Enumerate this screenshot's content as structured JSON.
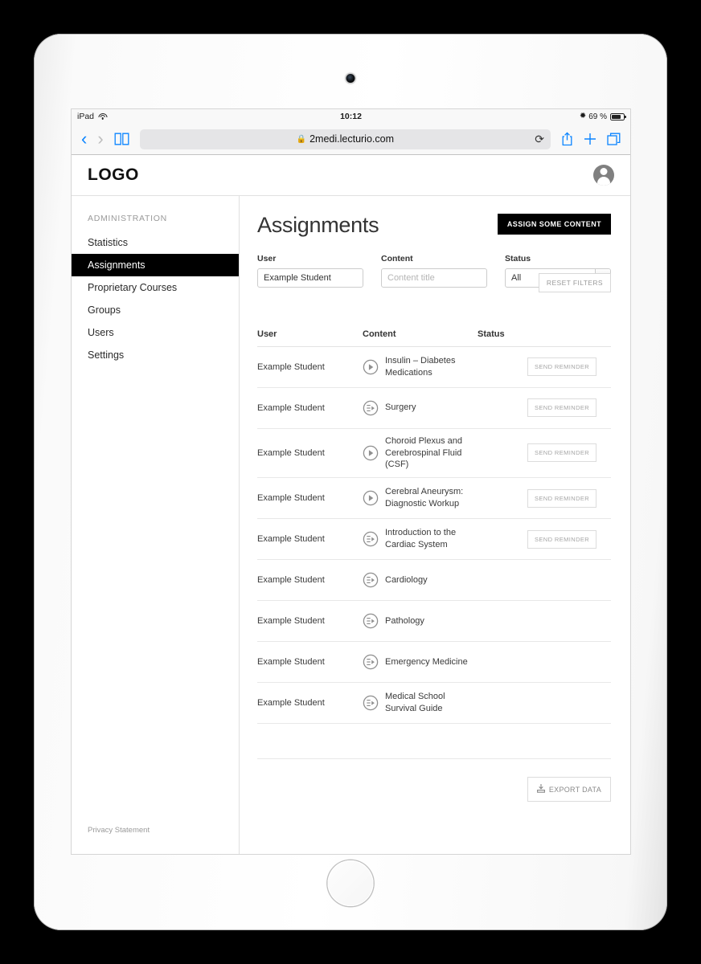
{
  "status_bar": {
    "device": "iPad",
    "wifi_icon": "wifi-icon",
    "time": "10:12",
    "bluetooth_icon": "bluetooth-icon",
    "battery_text": "69 %",
    "battery_icon": "battery-icon"
  },
  "browser": {
    "back_icon": "chevron-left-icon",
    "forward_icon": "chevron-right-icon",
    "bookmarks_icon": "book-icon",
    "lock_icon": "lock-icon",
    "url": "2medi.lecturio.com",
    "reload_icon": "reload-icon",
    "share_icon": "share-icon",
    "new_tab_icon": "plus-icon",
    "tabs_icon": "tabs-icon"
  },
  "app_header": {
    "logo": "LOGO",
    "avatar_icon": "user-avatar-icon"
  },
  "sidebar": {
    "section_title": "ADMINISTRATION",
    "items": [
      {
        "label": "Statistics",
        "active": false
      },
      {
        "label": "Assignments",
        "active": true
      },
      {
        "label": "Proprietary Courses",
        "active": false
      },
      {
        "label": "Groups",
        "active": false
      },
      {
        "label": "Users",
        "active": false
      },
      {
        "label": "Settings",
        "active": false
      }
    ],
    "privacy_link": "Privacy Statement"
  },
  "main": {
    "page_title": "Assignments",
    "assign_button": "ASSIGN SOME CONTENT",
    "reset_button": "RESET FILTERS",
    "export_button": "EXPORT DATA",
    "export_icon": "export-icon"
  },
  "filters": {
    "user": {
      "label": "User",
      "value": "Example Student",
      "placeholder": "User"
    },
    "content": {
      "label": "Content",
      "value": "",
      "placeholder": "Content title"
    },
    "status": {
      "label": "Status",
      "selected": "All",
      "options": [
        "All"
      ],
      "chevron_icon": "chevron-down-icon"
    }
  },
  "table": {
    "columns": [
      "User",
      "Content",
      "Status",
      ""
    ],
    "reminder_label": "SEND REMINDER",
    "rows": [
      {
        "user": "Example Student",
        "content": "Insulin – Diabetes Medications",
        "content_icon": "video-play-icon",
        "status": "orange",
        "status_icon": "warning-dot-icon",
        "has_reminder": true
      },
      {
        "user": "Example Student",
        "content": "Surgery",
        "content_icon": "course-playlist-icon",
        "status": "orange",
        "status_icon": "warning-dot-icon",
        "has_reminder": true
      },
      {
        "user": "Example Student",
        "content": "Choroid Plexus and Cerebrospinal Fluid (CSF)",
        "content_icon": "video-play-icon",
        "status": "orange",
        "status_icon": "warning-dot-icon",
        "has_reminder": true
      },
      {
        "user": "Example Student",
        "content": "Cerebral Aneurysm: Diagnostic Workup",
        "content_icon": "video-play-icon",
        "status": "orange",
        "status_icon": "warning-dot-icon",
        "has_reminder": true
      },
      {
        "user": "Example Student",
        "content": "Introduction to the Cardiac System",
        "content_icon": "course-playlist-icon",
        "status": "orange",
        "status_icon": "plain-dot-icon",
        "has_reminder": true
      },
      {
        "user": "Example Student",
        "content": "Cardiology",
        "content_icon": "course-playlist-icon",
        "status": "gray",
        "status_icon": "plain-dot-icon",
        "has_reminder": false
      },
      {
        "user": "Example Student",
        "content": "Pathology",
        "content_icon": "course-playlist-icon",
        "status": "gray",
        "status_icon": "plain-dot-icon",
        "has_reminder": false
      },
      {
        "user": "Example Student",
        "content": "Emergency Medicine",
        "content_icon": "course-playlist-icon",
        "status": "green",
        "status_icon": "plain-dot-icon",
        "has_reminder": false
      },
      {
        "user": "Example Student",
        "content": "Medical School Survival Guide",
        "content_icon": "course-playlist-icon",
        "status": "green",
        "status_icon": "plain-dot-icon",
        "has_reminder": false
      }
    ]
  },
  "colors": {
    "accent_black": "#000000",
    "status_orange": "#f5a623",
    "status_gray": "#8c8c8c",
    "status_green": "#52ae30",
    "link_blue": "#0a84ff"
  }
}
